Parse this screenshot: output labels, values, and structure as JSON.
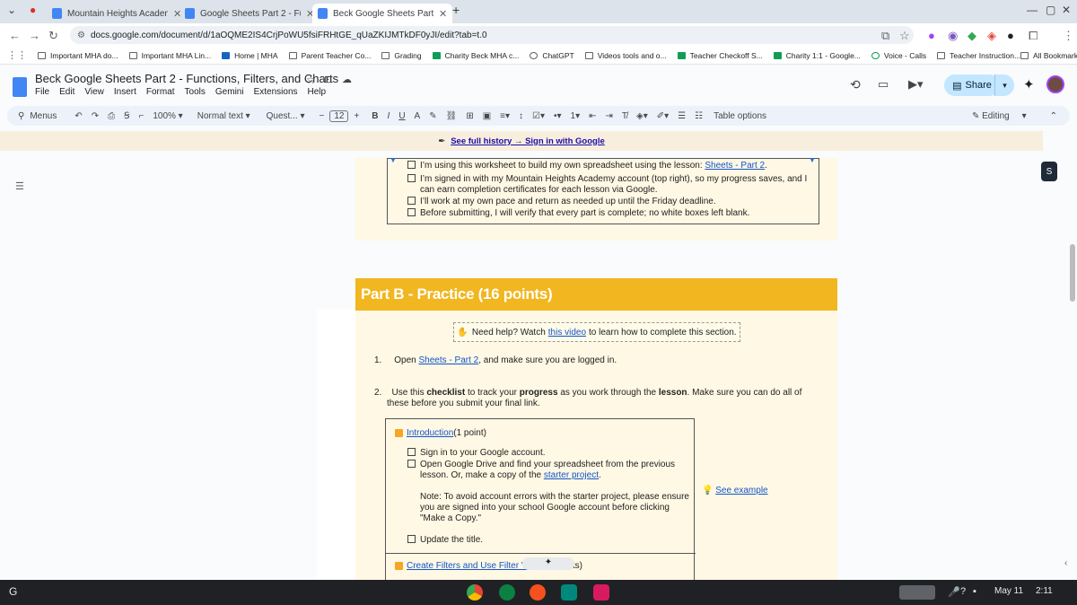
{
  "tabs": [
    {
      "label": "Mountain Heights Academy - C"
    },
    {
      "label": "Google Sheets Part 2 - Functio"
    },
    {
      "label": "Beck Google Sheets Part 2 - Fu"
    }
  ],
  "address": {
    "url": "docs.google.com/document/d/1aOQME2IS4CrjPoWU5fsiFRHtGE_qUaZKIJMTkDF0yJI/edit?tab=t.0"
  },
  "bookmarks": [
    {
      "label": "Important MHA do..."
    },
    {
      "label": "Important MHA Lin..."
    },
    {
      "label": "Home | MHA"
    },
    {
      "label": "Parent Teacher Co..."
    },
    {
      "label": "Grading"
    },
    {
      "label": "Charity Beck MHA c..."
    },
    {
      "label": "ChatGPT"
    },
    {
      "label": "Videos tools and o..."
    },
    {
      "label": "Teacher Checkoff S..."
    },
    {
      "label": "Charity 1:1 - Google..."
    },
    {
      "label": "Voice - Calls"
    },
    {
      "label": "Teacher Instruction..."
    }
  ],
  "all_bookmarks": "All Bookmarks",
  "doc": {
    "title": "Beck Google Sheets Part 2 - Functions, Filters, and Charts",
    "menu": [
      "File",
      "Edit",
      "View",
      "Insert",
      "Format",
      "Tools",
      "Gemini",
      "Extensions",
      "Help"
    ],
    "share": "Share"
  },
  "toolbar": {
    "menus": "Menus",
    "zoom": "100%",
    "style": "Normal text",
    "font": "Quest...",
    "size": "12",
    "table_options": "Table options",
    "mode": "Editing"
  },
  "banner": {
    "text": "See full history → Sign in with Google"
  },
  "checklist_top": [
    {
      "text": "I’m using this worksheet to build my own spreadsheet using the lesson: ",
      "link": "Sheets - Part 2",
      "end": "."
    },
    {
      "text": "I’m signed in with my Mountain Heights Academy account (top right), so my progress saves, and I can earn completion certificates for each lesson via Google."
    },
    {
      "text": "I’ll work at my own pace and return as needed up until the Friday deadline."
    },
    {
      "text": "Before submitting, I will verify that every part is complete; no white boxes left blank."
    }
  ],
  "part_b": {
    "heading": "Part B - Practice (16 points)",
    "help_prefix": "Need help? Watch ",
    "help_link": "this video",
    "help_suffix": " to learn how to complete this section.",
    "step1_num": "1.",
    "step1_pre": "Open ",
    "step1_link": "Sheets - Part 2",
    "step1_post": ", and make sure you are logged in.",
    "step2_num": "2.",
    "step2_a": "Use this ",
    "step2_b": "checklist",
    "step2_c": " to track your ",
    "step2_d": "progress",
    "step2_e": " as you work through the ",
    "step2_f": "lesson",
    "step2_g": ". Make sure you can do all of these before you submit your final link."
  },
  "table": {
    "intro_link": "Introduction",
    "intro_points": " (1 point)",
    "items": [
      "Sign in to your Google account.",
      "Open Google Drive and find your spreadsheet from the previous lesson. Or, make a copy of the ",
      "Update the title."
    ],
    "starter_link": "starter project",
    "note": "Note: To avoid account errors with the starter project, please ensure you are signed into your school Google account before clicking \"Make a Copy.\"",
    "filters_link": "Create Filters and Use Filter Views",
    "filters_points": " (3 points)",
    "example": "See example"
  },
  "taskbar": {
    "date": "May 11",
    "time": "2:11"
  }
}
